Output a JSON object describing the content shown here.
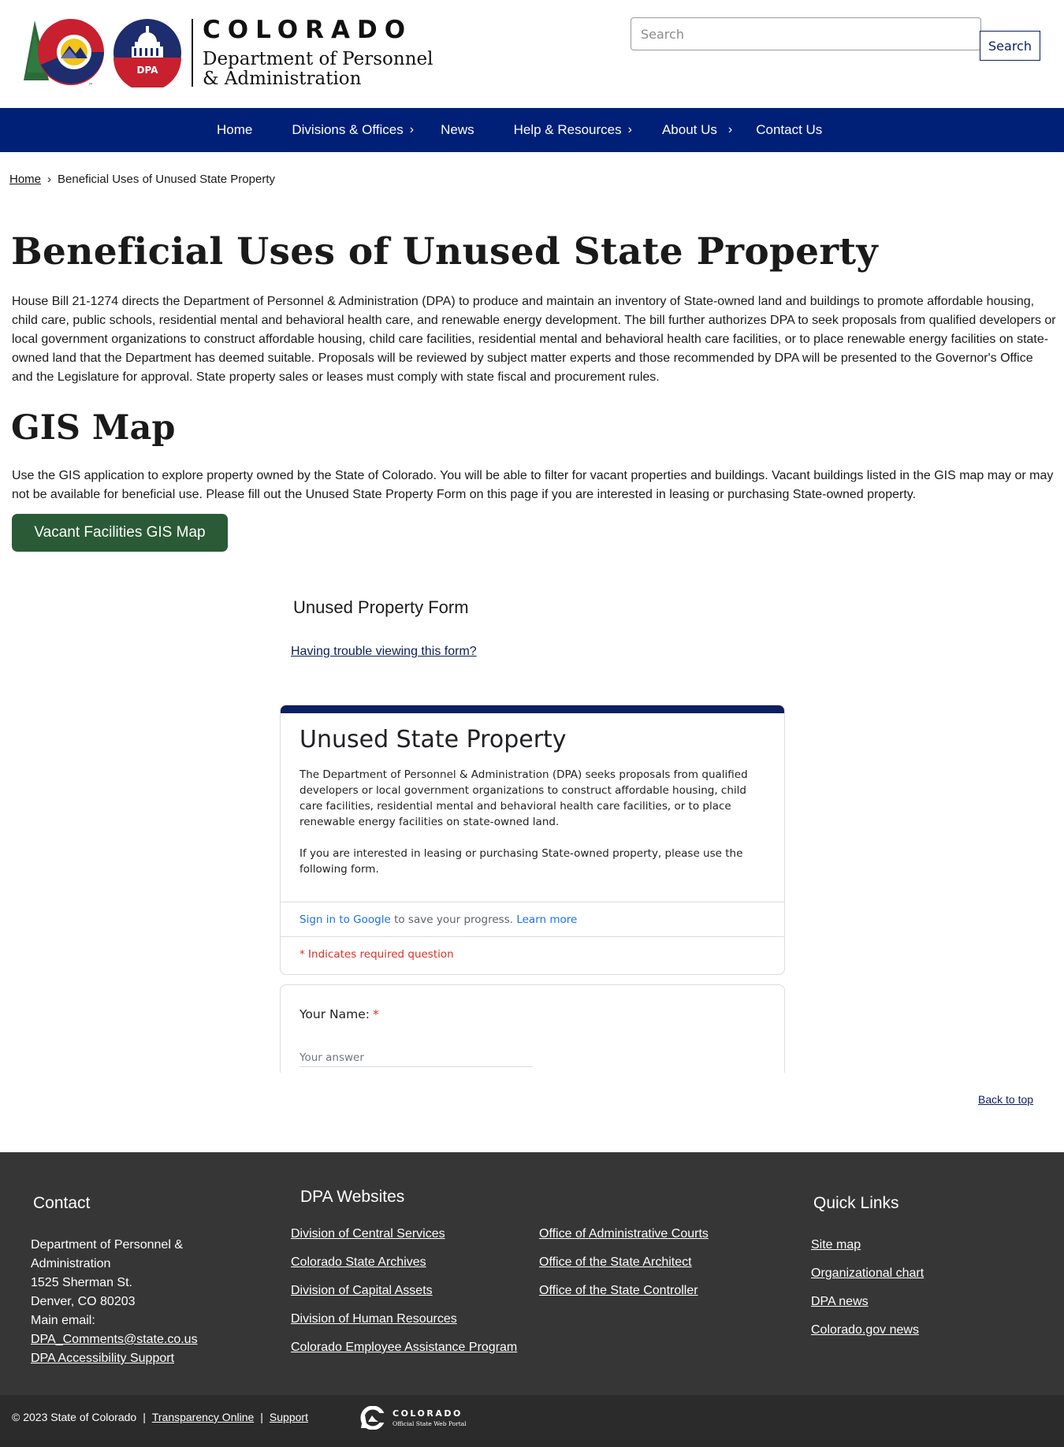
{
  "header": {
    "logo_colorado": "COLORADO",
    "logo_dept_line1": "Department of Personnel",
    "logo_dept_line2": "& Administration",
    "seal_text": "DPA",
    "search_placeholder": "Search",
    "search_button": "Search"
  },
  "nav": {
    "items": [
      {
        "label": "Home"
      },
      {
        "label": "Divisions & Offices"
      },
      {
        "label": "News"
      },
      {
        "label": "Help & Resources"
      },
      {
        "label": "About Us"
      },
      {
        "label": "Contact Us"
      }
    ],
    "chevron": "›"
  },
  "breadcrumb": {
    "home": "Home",
    "separator": "›",
    "current": "Beneficial Uses of Unused State Property"
  },
  "main": {
    "title": "Beneficial Uses of Unused State Property",
    "intro": "House Bill 21-1274 directs the Department of Personnel & Administration (DPA) to produce and maintain an inventory of State-owned land and buildings to promote affordable housing, child care, public schools, residential mental and behavioral health care, and renewable energy development. The bill further authorizes DPA to seek proposals from qualified developers or local government organizations to construct affordable housing, child care facilities, residential mental and behavioral health care facilities, or to place renewable energy facilities on state-owned land that the Department has deemed suitable. Proposals will be reviewed by subject matter experts and those recommended by DPA will be presented to the Governor's Office and the Legislature for approval. State property sales or leases must comply with state fiscal and procurement rules.",
    "gis_title": "GIS Map",
    "gis_text": "Use the GIS application to explore property owned by the State of Colorado. You will be able to filter for vacant properties and buildings. Vacant buildings listed in the GIS map may or may not be available for beneficial use. Please fill out the Unused State Property Form on this page if you are interested in leasing or purchasing State-owned property.",
    "gis_button": "Vacant Facilities GIS Map",
    "form_heading": "Unused Property Form",
    "trouble_link": "Having trouble viewing this form?",
    "back_to_top": "Back to top"
  },
  "gform": {
    "title": "Unused State Property",
    "desc_p1": "The Department of Personnel & Administration (DPA) seeks proposals from qualified developers or local government organizations to construct affordable housing, child care facilities, residential mental and behavioral health care facilities, or to place renewable energy facilities on state-owned land.",
    "desc_p2": "If you are interested in leasing or purchasing State-owned property, please use the following form.",
    "signin_link": "Sign in to Google",
    "signin_text": " to save your progress. ",
    "learn_more": "Learn more",
    "required_note": "* Indicates required question",
    "question1_label": "Your Name:",
    "required_star": "*",
    "answer_placeholder": "Your answer",
    "accent_color": "#0b1f62"
  },
  "footer": {
    "contact_title": "Contact",
    "contact_lines": [
      "Department of Personnel &",
      "Administration",
      "1525 Sherman St.",
      "Denver, CO 80203",
      "Main email:"
    ],
    "contact_email": "DPA_Comments@state.co.us",
    "accessibility": "DPA Accessibility Support",
    "websites_title": "DPA Websites",
    "websites_col1": [
      "Division of Central Services",
      "Colorado State Archives",
      "Division of Capital Assets",
      "Division of Human Resources",
      "Colorado Employee Assistance Program"
    ],
    "websites_col2": [
      "Office of Administrative Courts",
      "Office of the State Architect",
      "Office of the State Controller"
    ],
    "quick_title": "Quick Links",
    "quick_links": [
      "Site map",
      "Organizational chart",
      "DPA news",
      "Colorado.gov news"
    ]
  },
  "bottombar": {
    "copyright": "© 2023 State of Colorado",
    "pipe": "|",
    "transparency": "Transparency Online",
    "support": "Support",
    "portal_l1": "COLORADO",
    "portal_l2": "Official State Web Portal"
  },
  "colors": {
    "nav_bg": "#002078",
    "gis_button_bg": "#2a5b36",
    "footer_bg": "#363636",
    "bottombar_bg": "#2b2b2b"
  }
}
